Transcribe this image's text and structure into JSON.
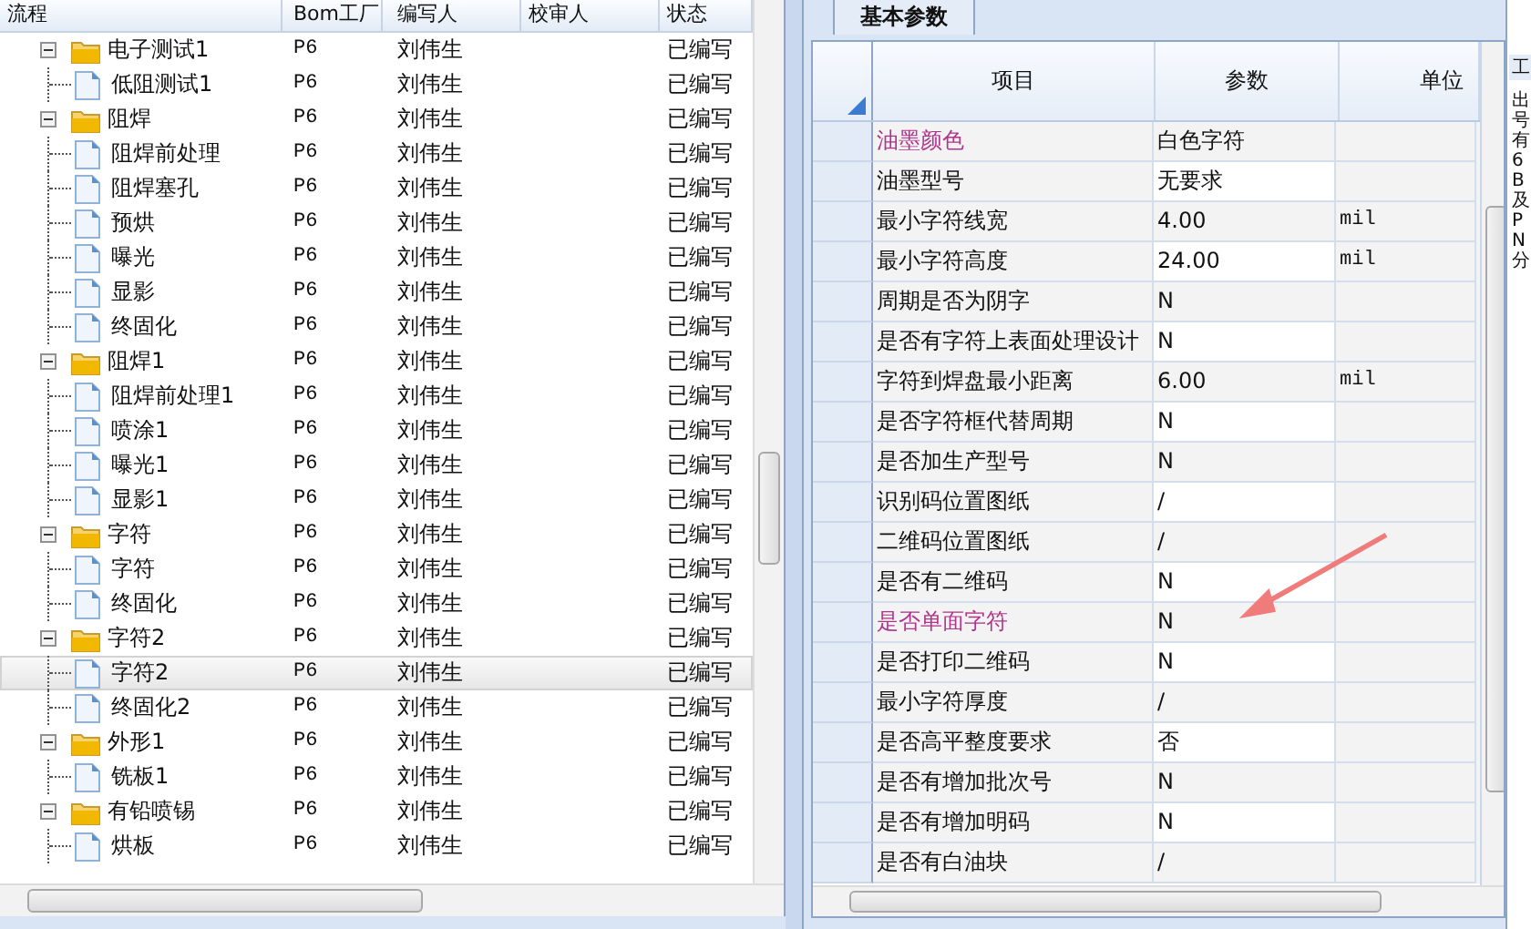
{
  "tree": {
    "columns": [
      "流程",
      "Bom工厂",
      "编写人",
      "校审人",
      "状态"
    ],
    "rows": [
      {
        "name": "电子测试1",
        "factory": "P6",
        "author": "刘伟生",
        "status": "已编写",
        "expanded": true,
        "selected": false,
        "children": [
          {
            "name": "低阻测试1",
            "factory": "P6",
            "author": "刘伟生",
            "status": "已编写",
            "selected": false
          }
        ]
      },
      {
        "name": "阻焊",
        "factory": "P6",
        "author": "刘伟生",
        "status": "已编写",
        "expanded": true,
        "selected": false,
        "children": [
          {
            "name": "阻焊前处理",
            "factory": "P6",
            "author": "刘伟生",
            "status": "已编写",
            "selected": false
          },
          {
            "name": "阻焊塞孔",
            "factory": "P6",
            "author": "刘伟生",
            "status": "已编写",
            "selected": false
          },
          {
            "name": "预烘",
            "factory": "P6",
            "author": "刘伟生",
            "status": "已编写",
            "selected": false
          },
          {
            "name": "曝光",
            "factory": "P6",
            "author": "刘伟生",
            "status": "已编写",
            "selected": false
          },
          {
            "name": "显影",
            "factory": "P6",
            "author": "刘伟生",
            "status": "已编写",
            "selected": false
          },
          {
            "name": "终固化",
            "factory": "P6",
            "author": "刘伟生",
            "status": "已编写",
            "selected": false
          }
        ]
      },
      {
        "name": "阻焊1",
        "factory": "P6",
        "author": "刘伟生",
        "status": "已编写",
        "expanded": true,
        "selected": false,
        "children": [
          {
            "name": "阻焊前处理1",
            "factory": "P6",
            "author": "刘伟生",
            "status": "已编写",
            "selected": false
          },
          {
            "name": "喷涂1",
            "factory": "P6",
            "author": "刘伟生",
            "status": "已编写",
            "selected": false
          },
          {
            "name": "曝光1",
            "factory": "P6",
            "author": "刘伟生",
            "status": "已编写",
            "selected": false
          },
          {
            "name": "显影1",
            "factory": "P6",
            "author": "刘伟生",
            "status": "已编写",
            "selected": false
          }
        ]
      },
      {
        "name": "字符",
        "factory": "P6",
        "author": "刘伟生",
        "status": "已编写",
        "expanded": true,
        "selected": false,
        "children": [
          {
            "name": "字符",
            "factory": "P6",
            "author": "刘伟生",
            "status": "已编写",
            "selected": false
          },
          {
            "name": "终固化",
            "factory": "P6",
            "author": "刘伟生",
            "status": "已编写",
            "selected": false
          }
        ]
      },
      {
        "name": "字符2",
        "factory": "P6",
        "author": "刘伟生",
        "status": "已编写",
        "expanded": true,
        "selected": false,
        "children": [
          {
            "name": "字符2",
            "factory": "P6",
            "author": "刘伟生",
            "status": "已编写",
            "selected": true
          },
          {
            "name": "终固化2",
            "factory": "P6",
            "author": "刘伟生",
            "status": "已编写",
            "selected": false
          }
        ]
      },
      {
        "name": "外形1",
        "factory": "P6",
        "author": "刘伟生",
        "status": "已编写",
        "expanded": true,
        "selected": false,
        "children": [
          {
            "name": "铣板1",
            "factory": "P6",
            "author": "刘伟生",
            "status": "已编写",
            "selected": false
          }
        ]
      },
      {
        "name": "有铅喷锡",
        "factory": "P6",
        "author": "刘伟生",
        "status": "已编写",
        "expanded": true,
        "selected": false,
        "children": [
          {
            "name": "烘板",
            "factory": "P6",
            "author": "刘伟生",
            "status": "已编写",
            "selected": false
          }
        ]
      }
    ]
  },
  "params": {
    "tab": {
      "label": "基本参数",
      "selected": true
    },
    "columns": [
      "项目",
      "参数",
      "单位"
    ],
    "rows": [
      {
        "item": "油墨颜色",
        "value": "白色字符",
        "highlight": true
      },
      {
        "item": "油墨型号",
        "value": "无要求",
        "highlight": false
      },
      {
        "item": "最小字符线宽",
        "value": "4.00",
        "unit": "mil",
        "highlight": false
      },
      {
        "item": "最小字符高度",
        "value": "24.00",
        "unit": "mil",
        "highlight": false
      },
      {
        "item": "周期是否为阴字",
        "value": "N",
        "highlight": false
      },
      {
        "item": "是否有字符上表面处理设计",
        "value": "N",
        "highlight": false
      },
      {
        "item": "字符到焊盘最小距离",
        "value": "6.00",
        "unit": "mil",
        "highlight": false
      },
      {
        "item": "是否字符框代替周期",
        "value": "N",
        "highlight": false
      },
      {
        "item": "是否加生产型号",
        "value": "N",
        "highlight": false
      },
      {
        "item": "识别码位置图纸",
        "value": "/",
        "highlight": false
      },
      {
        "item": "二维码位置图纸",
        "value": "/",
        "highlight": false
      },
      {
        "item": "是否有二维码",
        "value": "N",
        "highlight": false
      },
      {
        "item": "是否单面字符",
        "value": "N",
        "highlight": true
      },
      {
        "item": "是否打印二维码",
        "value": "N",
        "highlight": false
      },
      {
        "item": "最小字符厚度",
        "value": "/",
        "highlight": false
      },
      {
        "item": "是否高平整度要求",
        "value": "否",
        "highlight": false
      },
      {
        "item": "是否有增加批次号",
        "value": "N",
        "highlight": false
      },
      {
        "item": "是否有增加明码",
        "value": "N",
        "highlight": false
      },
      {
        "item": "是否有白油块",
        "value": "/",
        "highlight": false
      }
    ]
  },
  "side_panel": {
    "tab": "工",
    "text": "出号有6B及PN分"
  }
}
